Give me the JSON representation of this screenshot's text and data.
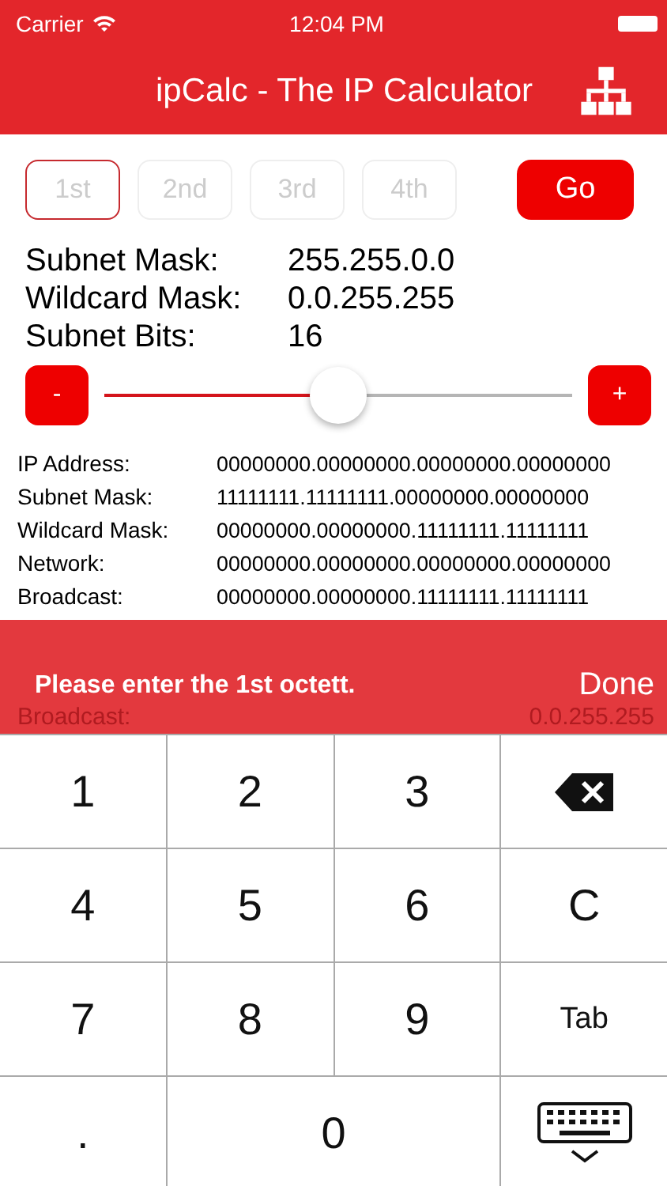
{
  "status_bar": {
    "carrier": "Carrier",
    "time": "12:04 PM"
  },
  "nav_bar": {
    "title": "ipCalc - The IP Calculator"
  },
  "octets": [
    {
      "placeholder": "1st",
      "selected": true
    },
    {
      "placeholder": "2nd",
      "selected": false
    },
    {
      "placeholder": "3rd",
      "selected": false
    },
    {
      "placeholder": "4th",
      "selected": false
    }
  ],
  "go_button": "Go",
  "summary": [
    {
      "label": "Subnet Mask:",
      "value": "255.255.0.0"
    },
    {
      "label": "Wildcard Mask:",
      "value": "0.0.255.255"
    },
    {
      "label": "Subnet Bits:",
      "value": "16"
    }
  ],
  "slider": {
    "minus": "-",
    "plus": "+",
    "level": 0.5
  },
  "binary": [
    {
      "label": "IP Address:",
      "value": "00000000.00000000.00000000.00000000"
    },
    {
      "label": "Subnet Mask:",
      "value": "11111111.11111111.00000000.00000000"
    },
    {
      "label": "Wildcard Mask:",
      "value": "00000000.00000000.11111111.11111111"
    },
    {
      "label": "Network:",
      "value": "00000000.00000000.00000000.00000000"
    },
    {
      "label": "Broadcast:",
      "value": "00000000.00000000.11111111.11111111"
    }
  ],
  "input_bar": {
    "message": "Please enter the 1st octett.",
    "done": "Done",
    "behind": {
      "label": "Broadcast:",
      "value": "0.0.255.255"
    }
  },
  "keyboard": [
    {
      "kind": "text",
      "label": "1"
    },
    {
      "kind": "text",
      "label": "2"
    },
    {
      "kind": "text",
      "label": "3"
    },
    {
      "kind": "backspace"
    },
    {
      "kind": "text",
      "label": "4"
    },
    {
      "kind": "text",
      "label": "5"
    },
    {
      "kind": "text",
      "label": "6"
    },
    {
      "kind": "text",
      "label": "C"
    },
    {
      "kind": "text",
      "label": "7"
    },
    {
      "kind": "text",
      "label": "8"
    },
    {
      "kind": "text",
      "label": "9"
    },
    {
      "kind": "small",
      "label": "Tab"
    },
    {
      "kind": "text",
      "label": "."
    },
    {
      "kind": "wide",
      "label": "0"
    },
    {
      "kind": "hide"
    }
  ]
}
